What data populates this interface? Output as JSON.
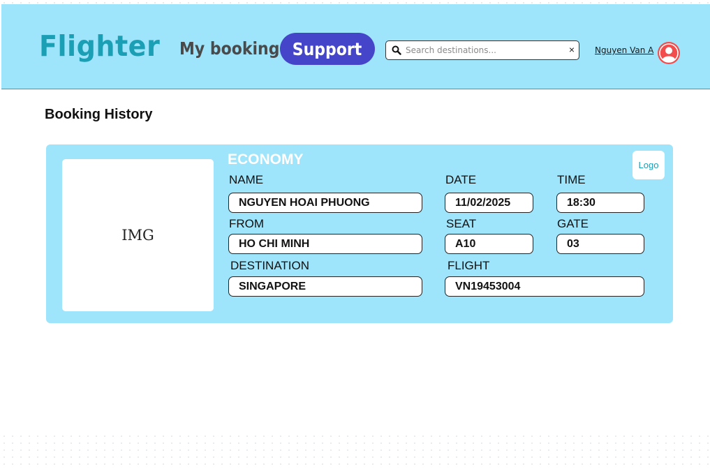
{
  "header": {
    "brand": "Flighter",
    "nav_my_booking": "My booking",
    "support_label": "Support",
    "search_placeholder": "Search destinations...",
    "search_value": "",
    "clear_symbol": "×",
    "user_name": "Nguyen Van A"
  },
  "page": {
    "title": "Booking History"
  },
  "ticket": {
    "image_placeholder": "IMG",
    "class": "ECONOMY",
    "logo": "Logo",
    "labels": {
      "name": "NAME",
      "date": "DATE",
      "time": "TIME",
      "from": "FROM",
      "seat": "SEAT",
      "gate": "GATE",
      "destination": "DESTINATION",
      "flight": "FLIGHT"
    },
    "values": {
      "name": "NGUYEN HOAI PHUONG",
      "date": "11/02/2025",
      "time": "18:30",
      "from": "HO CHI MINH",
      "seat": "A10",
      "gate": "03",
      "destination": "SINGAPORE",
      "flight": "VN19453004"
    }
  },
  "colors": {
    "header_bg": "#9ee4fb",
    "brand": "#1a9fb4",
    "support_bg": "#4545c9",
    "avatar": "#f24c4c",
    "ticket_bg": "#9ee4fb"
  },
  "icons": {
    "search": "search-icon",
    "clear": "close-icon",
    "avatar": "user-avatar-icon"
  }
}
